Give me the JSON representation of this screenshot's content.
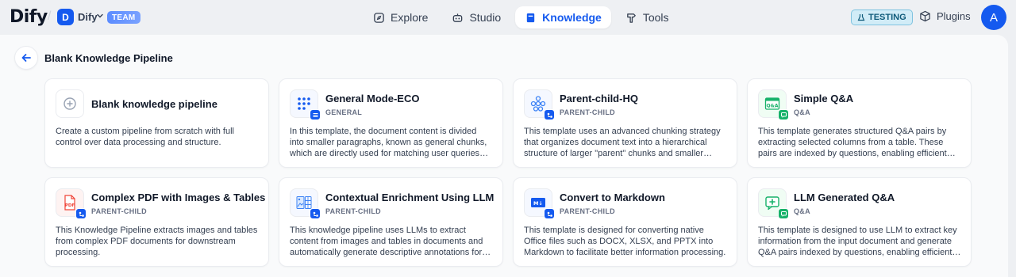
{
  "app": {
    "logo_text": "Dify",
    "workspace_initial": "D",
    "workspace_name": "Dify",
    "team_badge": "TEAM"
  },
  "nav": {
    "explore": "Explore",
    "studio": "Studio",
    "knowledge": "Knowledge",
    "tools": "Tools"
  },
  "env_badge": "TESTING",
  "plugins_label": "Plugins",
  "user_initial": "A",
  "page_title": "Blank Knowledge Pipeline",
  "colors": {
    "accent": "#155aef",
    "qa": "#17b26a"
  },
  "templates": [
    {
      "title": "Blank knowledge pipeline",
      "type": "",
      "icon": "plus-circle-icon",
      "desc": "Create a custom pipeline from scratch with full control over data processing and structure."
    },
    {
      "title": "General Mode-ECO",
      "type": "GENERAL",
      "icon": "dots-grid-icon",
      "desc": "In this template, the document content is divided into smaller paragraphs, known as general chunks, which are directly used for matching user queries and retrieval in Economical indexing mode."
    },
    {
      "title": "Parent-child-HQ",
      "type": "PARENT-CHILD",
      "icon": "hierarchy-icon",
      "desc": "This template uses an advanced chunking strategy that organizes document text into a hierarchical structure of larger \"parent\" chunks and smaller \"child\" chunks."
    },
    {
      "title": "Simple Q&A",
      "type": "Q&A",
      "icon": "qa-table-icon",
      "desc": "This template generates structured Q&A pairs by extracting selected columns from a table. These pairs are indexed by questions, enabling efficient retrieval of relevant answers."
    },
    {
      "title": "Complex PDF with Images & Tables",
      "type": "PARENT-CHILD",
      "icon": "pdf-icon",
      "desc": "This Knowledge Pipeline extracts images and tables from complex PDF documents for downstream processing."
    },
    {
      "title": "Contextual Enrichment Using LLM",
      "type": "PARENT-CHILD",
      "icon": "image-table-icon",
      "desc": "This knowledge pipeline uses LLMs to extract content from images and tables in documents and automatically generate descriptive annotations for contextual enrichment."
    },
    {
      "title": "Convert to Markdown",
      "type": "PARENT-CHILD",
      "icon": "markdown-icon",
      "desc": "This template is designed for converting native Office files such as DOCX, XLSX, and PPTX into Markdown to facilitate better information processing."
    },
    {
      "title": "LLM Generated Q&A",
      "type": "Q&A",
      "icon": "qa-chat-icon",
      "desc": "This template is designed to use LLM to extract key information from the input document and generate Q&A pairs indexed by questions, enabling efficient retrieval."
    }
  ]
}
